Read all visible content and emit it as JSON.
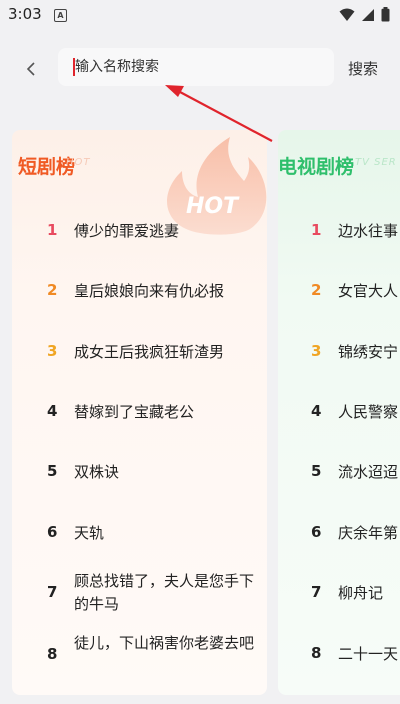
{
  "status": {
    "time": "3:03",
    "notification_glyph": "A"
  },
  "search": {
    "placeholder": "输入名称搜索",
    "value": "",
    "button_label": "搜索"
  },
  "short_drama": {
    "title": "短剧榜",
    "subtitle": "HOT",
    "badge_text": "HOT",
    "items": [
      {
        "rank": "1",
        "title": "傅少的罪爱逃妻"
      },
      {
        "rank": "2",
        "title": "皇后娘娘向来有仇必报"
      },
      {
        "rank": "3",
        "title": "成女王后我疯狂斩渣男"
      },
      {
        "rank": "4",
        "title": "替嫁到了宝藏老公"
      },
      {
        "rank": "5",
        "title": "双株诀"
      },
      {
        "rank": "6",
        "title": "天轨"
      },
      {
        "rank": "7",
        "title": "顾总找错了，夫人是您手下的牛马"
      },
      {
        "rank": "8",
        "title": "徒儿，下山祸害你老婆去吧"
      }
    ]
  },
  "tv_drama": {
    "title": "电视剧榜",
    "subtitle": "TV SER",
    "items": [
      {
        "rank": "1",
        "title": "边水往事"
      },
      {
        "rank": "2",
        "title": "女官大人"
      },
      {
        "rank": "3",
        "title": "锦绣安宁"
      },
      {
        "rank": "4",
        "title": "人民警察"
      },
      {
        "rank": "5",
        "title": "流水迢迢"
      },
      {
        "rank": "6",
        "title": "庆余年第"
      },
      {
        "rank": "7",
        "title": "柳舟记"
      },
      {
        "rank": "8",
        "title": "二十一天"
      }
    ]
  },
  "colors": {
    "rank1": "#e84a5f",
    "rank2": "#f08a24",
    "rank3": "#f0a524",
    "short_accent": "#f05a24",
    "tv_accent": "#2fbf6c",
    "annotation_arrow": "#e0242c"
  }
}
